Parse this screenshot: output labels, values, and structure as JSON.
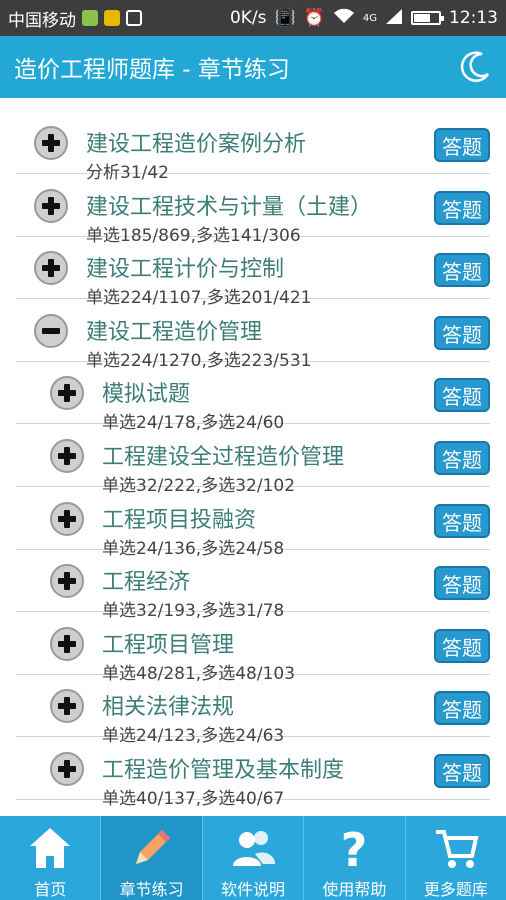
{
  "status": {
    "carrier": "中国移动",
    "speed": "0K/s",
    "network": "4G",
    "time": "12:13"
  },
  "title": "造价工程师题库 - 章节练习",
  "answer_label": "答题",
  "rows": [
    {
      "title": "建设工程造价案例分析",
      "stat": "分析31/42",
      "level": 0,
      "expanded": false
    },
    {
      "title": "建设工程技术与计量（土建）",
      "stat": "单选185/869,多选141/306",
      "level": 0,
      "expanded": false
    },
    {
      "title": "建设工程计价与控制",
      "stat": "单选224/1107,多选201/421",
      "level": 0,
      "expanded": false
    },
    {
      "title": "建设工程造价管理",
      "stat": "单选224/1270,多选223/531",
      "level": 0,
      "expanded": true
    },
    {
      "title": "模拟试题",
      "stat": "单选24/178,多选24/60",
      "level": 1,
      "expanded": false
    },
    {
      "title": "工程建设全过程造价管理",
      "stat": "单选32/222,多选32/102",
      "level": 1,
      "expanded": false
    },
    {
      "title": "工程项目投融资",
      "stat": "单选24/136,多选24/58",
      "level": 1,
      "expanded": false
    },
    {
      "title": "工程经济",
      "stat": "单选32/193,多选31/78",
      "level": 1,
      "expanded": false
    },
    {
      "title": "工程项目管理",
      "stat": "单选48/281,多选48/103",
      "level": 1,
      "expanded": false
    },
    {
      "title": "相关法律法规",
      "stat": "单选24/123,多选24/63",
      "level": 1,
      "expanded": false
    },
    {
      "title": "工程造价管理及基本制度",
      "stat": "单选40/137,多选40/67",
      "level": 1,
      "expanded": false
    }
  ],
  "tabs": [
    {
      "label": "首页",
      "icon": "home-icon",
      "active": false
    },
    {
      "label": "章节练习",
      "icon": "pencil-icon",
      "active": true
    },
    {
      "label": "软件说明",
      "icon": "users-icon",
      "active": false
    },
    {
      "label": "使用帮助",
      "icon": "question-icon",
      "active": false
    },
    {
      "label": "更多题库",
      "icon": "cart-icon",
      "active": false
    }
  ]
}
